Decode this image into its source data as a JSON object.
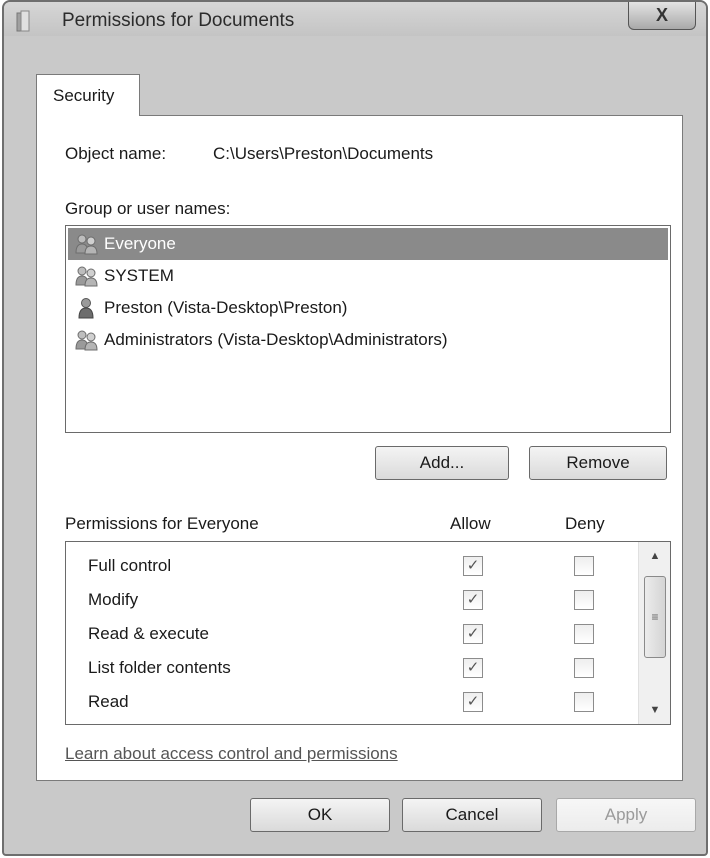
{
  "window": {
    "title": "Permissions for Documents",
    "close_label": "X"
  },
  "tab": {
    "label": "Security"
  },
  "object": {
    "label": "Object name:",
    "value": "C:\\Users\\Preston\\Documents"
  },
  "groups": {
    "label": "Group or user names:",
    "items": [
      {
        "name": "Everyone",
        "icon": "group-icon",
        "selected": true
      },
      {
        "name": "SYSTEM",
        "icon": "group-icon",
        "selected": false
      },
      {
        "name": "Preston (Vista-Desktop\\Preston)",
        "icon": "user-icon",
        "selected": false
      },
      {
        "name": "Administrators (Vista-Desktop\\Administrators)",
        "icon": "group-icon",
        "selected": false
      }
    ]
  },
  "buttons": {
    "add": "Add...",
    "remove": "Remove",
    "ok": "OK",
    "cancel": "Cancel",
    "apply": "Apply"
  },
  "permissions": {
    "header": "Permissions for Everyone",
    "allow_header": "Allow",
    "deny_header": "Deny",
    "rows": [
      {
        "name": "Full control",
        "allow": true,
        "deny": false
      },
      {
        "name": "Modify",
        "allow": true,
        "deny": false
      },
      {
        "name": "Read & execute",
        "allow": true,
        "deny": false
      },
      {
        "name": "List folder contents",
        "allow": true,
        "deny": false
      },
      {
        "name": "Read",
        "allow": true,
        "deny": false
      }
    ]
  },
  "link": {
    "text": "Learn about access control and permissions"
  },
  "colors": {
    "selection": "#8a8a8a",
    "chrome": "#c9c9c9"
  }
}
